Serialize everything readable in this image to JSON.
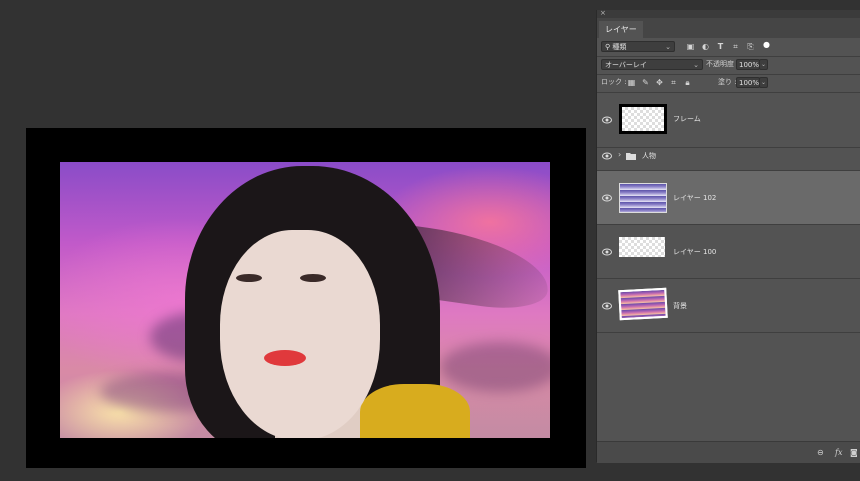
{
  "panel": {
    "tab_label": "レイヤー",
    "filter": {
      "value": "種類",
      "icon": "search-icon"
    },
    "filter_icons": [
      "image-filter-icon",
      "adjustment-filter-icon",
      "type-filter-icon",
      "shape-filter-icon",
      "smartobject-filter-icon",
      "filter-toggle-dot"
    ],
    "blend_mode": "オーバーレイ",
    "opacity_label": "不透明度 :",
    "opacity_value": "100%",
    "lock_label": "ロック :",
    "lock_icons": [
      "lock-transparent-icon",
      "lock-pixels-icon",
      "lock-position-icon",
      "lock-artboard-icon",
      "lock-all-icon"
    ],
    "fill_label": "塗り :",
    "fill_value": "100%",
    "layers": [
      {
        "name": "フレーム",
        "visible": true,
        "selected": false,
        "thumbnail": "frame"
      },
      {
        "name": "人物",
        "visible": true,
        "selected": false,
        "type": "group",
        "collapsed": true
      },
      {
        "name": "レイヤー 102",
        "visible": true,
        "selected": true,
        "thumbnail": "gradient"
      },
      {
        "name": "レイヤー 100",
        "visible": true,
        "selected": false,
        "thumbnail": "transparent"
      },
      {
        "name": "背景",
        "visible": true,
        "selected": false,
        "thumbnail": "photo"
      }
    ],
    "footer_icons": [
      "link-icon",
      "fx-icon",
      "mask-icon"
    ]
  },
  "document": {
    "image_description_icon": "portrait-photo"
  }
}
